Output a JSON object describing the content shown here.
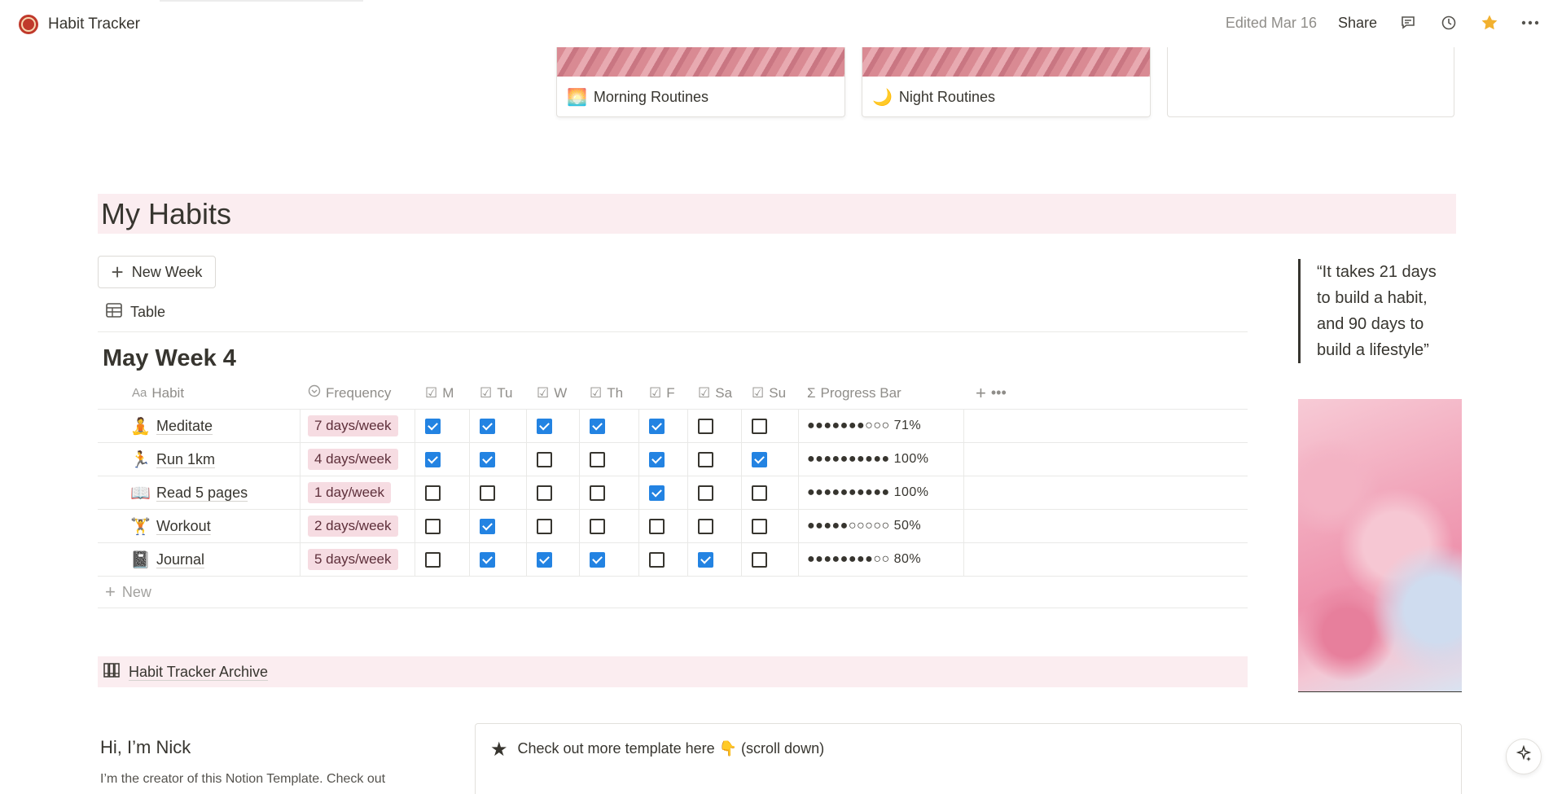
{
  "topbar": {
    "title": "Habit Tracker",
    "edited": "Edited Mar 16",
    "share": "Share"
  },
  "gallery": [
    {
      "emoji": "🌅",
      "label": "Morning Routines"
    },
    {
      "emoji": "🌙",
      "label": "Night Routines"
    }
  ],
  "page": {
    "heading": "My Habits",
    "new_week": "New Week",
    "view_tab": "Table",
    "week_title": "May Week 4"
  },
  "table": {
    "headers": {
      "habit": "Habit",
      "habit_icon": "Aa",
      "frequency": "Frequency",
      "m": "M",
      "tu": "Tu",
      "w": "W",
      "th": "Th",
      "f": "F",
      "sa": "Sa",
      "su": "Su",
      "progress": "Progress Bar"
    },
    "rows": [
      {
        "icon": "meditate-icon",
        "glyph": "🧘",
        "name": "Meditate",
        "frequency": "7 days/week",
        "days": [
          true,
          true,
          true,
          true,
          true,
          false,
          false
        ],
        "progress": "●●●●●●●○○○ 71%"
      },
      {
        "icon": "run-icon",
        "glyph": "🏃",
        "name": "Run 1km",
        "frequency": "4 days/week",
        "days": [
          true,
          true,
          false,
          false,
          true,
          false,
          true
        ],
        "progress": "●●●●●●●●●● 100%"
      },
      {
        "icon": "book-icon",
        "glyph": "📖",
        "name": "Read 5 pages",
        "frequency": "1 day/week",
        "days": [
          false,
          false,
          false,
          false,
          true,
          false,
          false
        ],
        "progress": "●●●●●●●●●● 100%"
      },
      {
        "icon": "workout-icon",
        "glyph": "🏋",
        "name": "Workout",
        "frequency": "2 days/week",
        "days": [
          false,
          true,
          false,
          false,
          false,
          false,
          false
        ],
        "progress": "●●●●●○○○○○ 50%"
      },
      {
        "icon": "journal-icon",
        "glyph": "📓",
        "name": "Journal",
        "frequency": "5 days/week",
        "days": [
          false,
          true,
          true,
          true,
          false,
          true,
          false
        ],
        "progress": "●●●●●●●●○○ 80%"
      }
    ],
    "new_label": "New"
  },
  "archive": {
    "label": "Habit Tracker Archive"
  },
  "quote": "“It takes 21 days to build a habit, and 90 days to build a lifestyle”",
  "bottom": {
    "hi_title": "Hi, I’m Nick",
    "hi_body": "I’m the creator of this Notion Template. Check out",
    "callout": "Check out more template here 👇 (scroll down)"
  },
  "colors": {
    "band": "#fbedf0",
    "pill": "#f6dce2",
    "checkbox_on": "#2383e2"
  }
}
